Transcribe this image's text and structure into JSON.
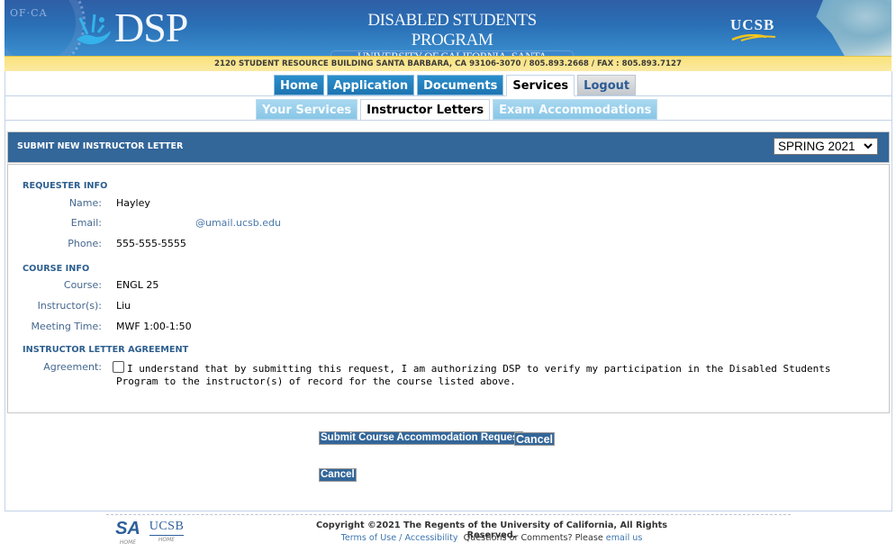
{
  "header": {
    "seal_text": "OF·CA",
    "logo_text": "DSP",
    "program_title": "DISABLED STUDENTS PROGRAM",
    "university": "UNIVERSITY OF CALIFORNIA, SANTA BARBARA",
    "ucsb_logo": "UCSB",
    "address": "2120 STUDENT RESOURCE BUILDING SANTA BARBARA, CA 93106-3070 / 805.893.2668 / FAX : 805.893.7127"
  },
  "nav": {
    "tabs": [
      {
        "label": "Home",
        "active": false
      },
      {
        "label": "Application",
        "active": false
      },
      {
        "label": "Documents",
        "active": false
      },
      {
        "label": "Services",
        "active": true
      },
      {
        "label": "Logout",
        "active": false
      }
    ],
    "subtabs": [
      {
        "label": "Your Services",
        "active": false
      },
      {
        "label": "Instructor Letters",
        "active": true
      },
      {
        "label": "Exam Accommodations",
        "active": false
      }
    ]
  },
  "panel": {
    "title": "SUBMIT NEW INSTRUCTOR LETTER",
    "term_selected": "SPRING 2021"
  },
  "requester": {
    "section_title": "REQUESTER INFO",
    "name_label": "Name:",
    "name": "Hayley",
    "email_label": "Email:",
    "email": "@umail.ucsb.edu",
    "phone_label": "Phone:",
    "phone": "555-555-5555"
  },
  "course": {
    "section_title": "COURSE INFO",
    "course_label": "Course:",
    "course": "ENGL 25",
    "instructor_label": "Instructor(s):",
    "instructor": "Liu",
    "meeting_label": "Meeting Time:",
    "meeting": "MWF 1:00-1:50"
  },
  "agreement": {
    "section_title": "INSTRUCTOR LETTER AGREEMENT",
    "label": "Agreement:",
    "checked": false,
    "text": "I understand that by submitting this request, I am authorizing DSP to verify my participation in the Disabled Students Program to the instructor(s) of record for the course listed above."
  },
  "buttons": {
    "submit": "Submit Course Accommodation Request",
    "cancel": "Cancel",
    "cancel_bottom": "Cancel"
  },
  "footer": {
    "sa_logo": "SA",
    "sa_home": "HOME",
    "ucsb_logo": "UCSB",
    "ucsb_home": "HOME",
    "copyright": "Copyright ©2021 The Regents of the University of California, All Rights Reserved.",
    "terms": "Terms of Use",
    "separator": " / ",
    "accessibility": "Accessibility",
    "questions": "Questions or Comments? Please",
    "email_us": "email us"
  },
  "colors": {
    "panel_header": "#336699",
    "tab_blue": "#1d74b1",
    "subtab_blue": "#88c6e6",
    "address_bar": "#f9e27a",
    "link": "#3d76b0"
  }
}
